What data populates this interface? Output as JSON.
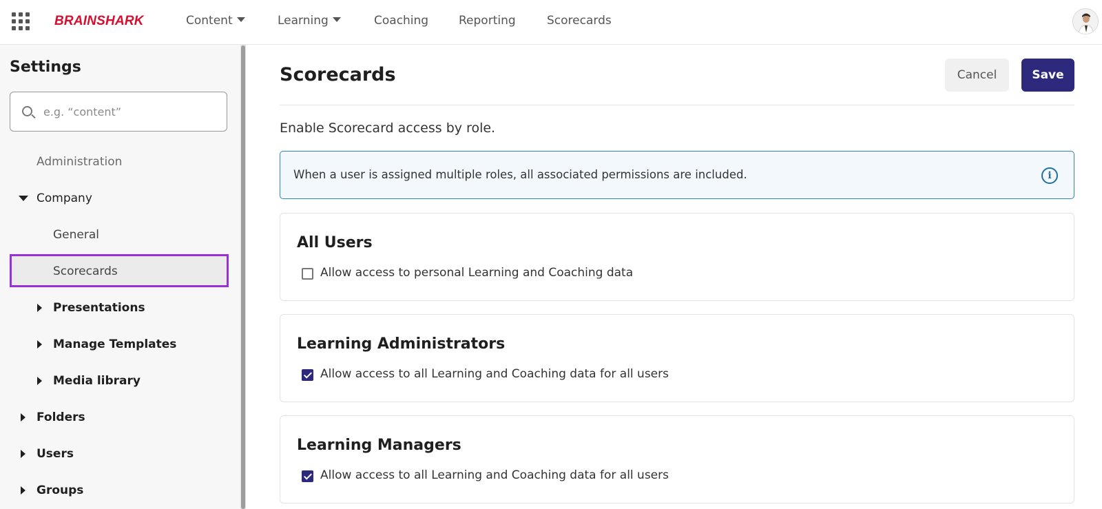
{
  "topbar": {
    "logo": "BRAINSHARK",
    "nav": [
      {
        "label": "Content",
        "has_caret": true
      },
      {
        "label": "Learning",
        "has_caret": true
      },
      {
        "label": "Coaching",
        "has_caret": false
      },
      {
        "label": "Reporting",
        "has_caret": false
      },
      {
        "label": "Scorecards",
        "has_caret": false
      }
    ],
    "icons": {
      "apps": "grid-apps-icon",
      "avatar": "user-avatar"
    }
  },
  "sidebar": {
    "title": "Settings",
    "search_placeholder": "e.g. “content”",
    "items": [
      {
        "label": "Administration",
        "level": 0,
        "expander": "none"
      },
      {
        "label": "Company",
        "level": 0,
        "expander": "expanded"
      },
      {
        "label": "General",
        "level": 1,
        "expander": "none"
      },
      {
        "label": "Scorecards",
        "level": 1,
        "expander": "none",
        "selected": true
      },
      {
        "label": "Presentations",
        "level": 1,
        "expander": "collapsed"
      },
      {
        "label": "Manage Templates",
        "level": 1,
        "expander": "collapsed"
      },
      {
        "label": "Media library",
        "level": 1,
        "expander": "collapsed"
      },
      {
        "label": "Folders",
        "level": 0,
        "expander": "collapsed"
      },
      {
        "label": "Users",
        "level": 0,
        "expander": "collapsed"
      },
      {
        "label": "Groups",
        "level": 0,
        "expander": "collapsed"
      }
    ],
    "selected_color": "#9b30d9"
  },
  "main": {
    "title": "Scorecards",
    "cancel_label": "Cancel",
    "save_label": "Save",
    "subtitle": "Enable Scorecard access by role.",
    "info": "When a user is assigned multiple roles, all associated permissions are included.",
    "roles": [
      {
        "title": "All Users",
        "permission": "Allow access to personal Learning and Coaching data",
        "checked": false
      },
      {
        "title": "Learning Administrators",
        "permission": "Allow access to all Learning and Coaching data for all users",
        "checked": true
      },
      {
        "title": "Learning Managers",
        "permission": "Allow access to all Learning and Coaching data for all users",
        "checked": true
      }
    ]
  },
  "colors": {
    "brand": "#d40f2f",
    "primary": "#2d2a7e",
    "info_border": "#2f86b8"
  }
}
